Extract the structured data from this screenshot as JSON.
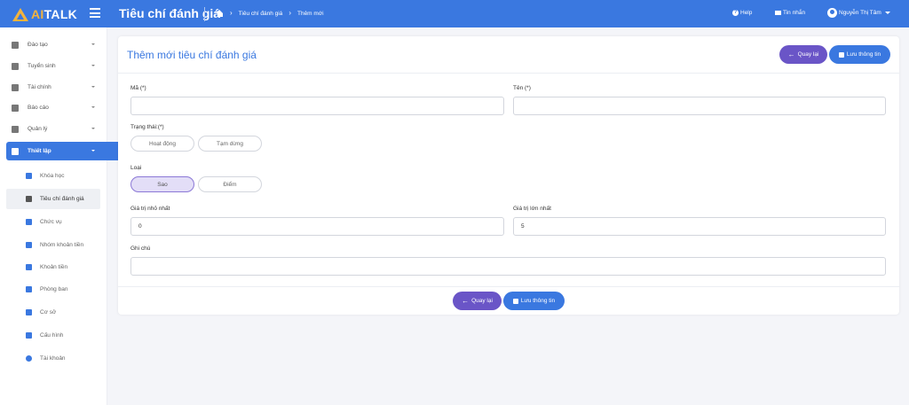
{
  "brand": {
    "logo_text_a": "AI",
    "logo_text_b": "TALK"
  },
  "header": {
    "title": "Tiêu chí đánh giá",
    "breadcrumb": {
      "item1": "Tiêu chí đánh giá",
      "item2": "Thêm mới"
    },
    "help_label": "Help",
    "messages_label": "Tin nhắn",
    "user_name": "Nguyễn Thị Tâm"
  },
  "sidebar": {
    "items": [
      {
        "label": "Đào tạo"
      },
      {
        "label": "Tuyển sinh"
      },
      {
        "label": "Tài chính"
      },
      {
        "label": "Báo cáo"
      },
      {
        "label": "Quản lý"
      },
      {
        "label": "Thiết lập"
      }
    ],
    "subitems": [
      {
        "label": "Khóa học"
      },
      {
        "label": "Tiêu chí đánh giá"
      },
      {
        "label": "Chức vụ"
      },
      {
        "label": "Nhóm khoản tiền"
      },
      {
        "label": "Khoản tiền"
      },
      {
        "label": "Phòng ban"
      },
      {
        "label": "Cơ sở"
      },
      {
        "label": "Cấu hình"
      },
      {
        "label": "Tài khoản"
      }
    ]
  },
  "form": {
    "title": "Thêm mới tiêu chí đánh giá",
    "back_label": "Quay lại",
    "save_label": "Lưu thông tin",
    "code_label": "Mã (*)",
    "code_value": "",
    "name_label": "Tên (*)",
    "name_value": "",
    "status_label": "Trạng thái:(*)",
    "status_options": [
      "Hoạt động",
      "Tạm dừng"
    ],
    "type_label": "Loại",
    "type_options": [
      "Sao",
      "Điểm"
    ],
    "type_selected": "Sao",
    "min_label": "Giá trị nhỏ nhất",
    "min_value": "0",
    "max_label": "Giá trị lớn nhất",
    "max_value": "5",
    "note_label": "Ghi chú",
    "note_value": ""
  },
  "colors": {
    "primary": "#3a78e0",
    "secondary": "#6a55c7",
    "logo_accent": "#f2b33d"
  }
}
